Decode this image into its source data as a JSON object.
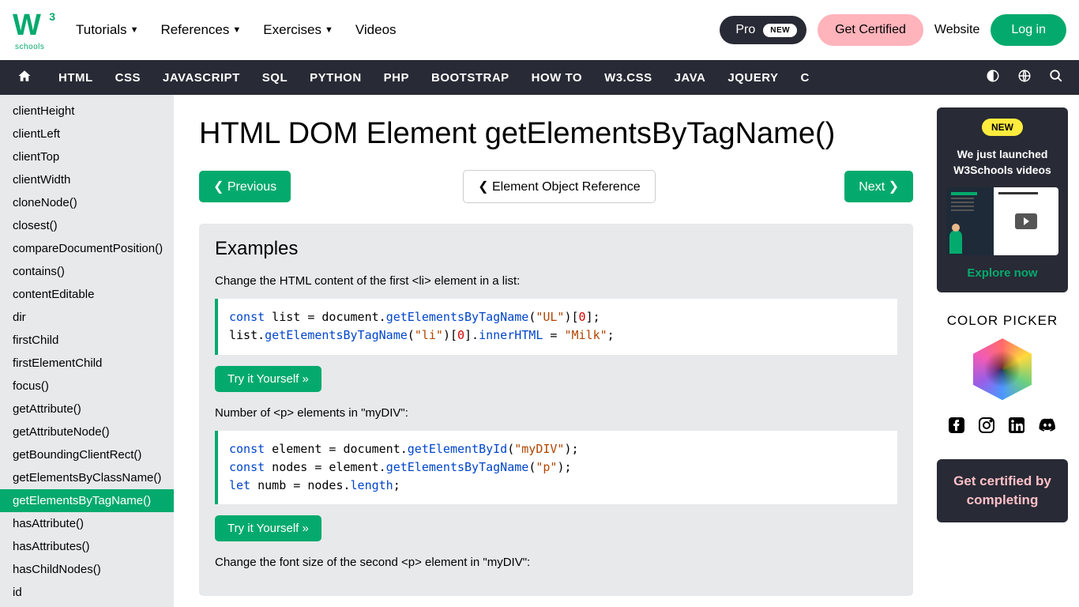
{
  "top": {
    "tutorials": "Tutorials",
    "references": "References",
    "exercises": "Exercises",
    "videos": "Videos",
    "pro": "Pro",
    "new": "NEW",
    "cert": "Get Certified",
    "website": "Website",
    "login": "Log in"
  },
  "langs": [
    "HTML",
    "CSS",
    "JAVASCRIPT",
    "SQL",
    "PYTHON",
    "PHP",
    "BOOTSTRAP",
    "HOW TO",
    "W3.CSS",
    "JAVA",
    "JQUERY",
    "C"
  ],
  "sidebar": {
    "items": [
      "clientHeight",
      "clientLeft",
      "clientTop",
      "clientWidth",
      "cloneNode()",
      "closest()",
      "compareDocumentPosition()",
      "contains()",
      "contentEditable",
      "dir",
      "firstChild",
      "firstElementChild",
      "focus()",
      "getAttribute()",
      "getAttributeNode()",
      "getBoundingClientRect()",
      "getElementsByClassName()",
      "getElementsByTagName()",
      "hasAttribute()",
      "hasAttributes()",
      "hasChildNodes()",
      "id"
    ],
    "active_index": 17
  },
  "page": {
    "title": "HTML DOM Element getElementsByTagName()",
    "prev": "Previous",
    "ref": "Element Object Reference",
    "next": "Next",
    "examples_heading": "Examples",
    "ex1_desc": "Change the HTML content of the first <li> element in a list:",
    "ex2_desc": "Number of <p> elements in \"myDIV\":",
    "ex3_desc": "Change the font size of the second <p> element in \"myDIV\":",
    "try": "Try it Yourself »"
  },
  "right": {
    "new_badge": "NEW",
    "video_text": "We just launched W3Schools videos",
    "explore": "Explore now",
    "color_picker": "COLOR PICKER",
    "cert_text": "Get certified by completing"
  }
}
